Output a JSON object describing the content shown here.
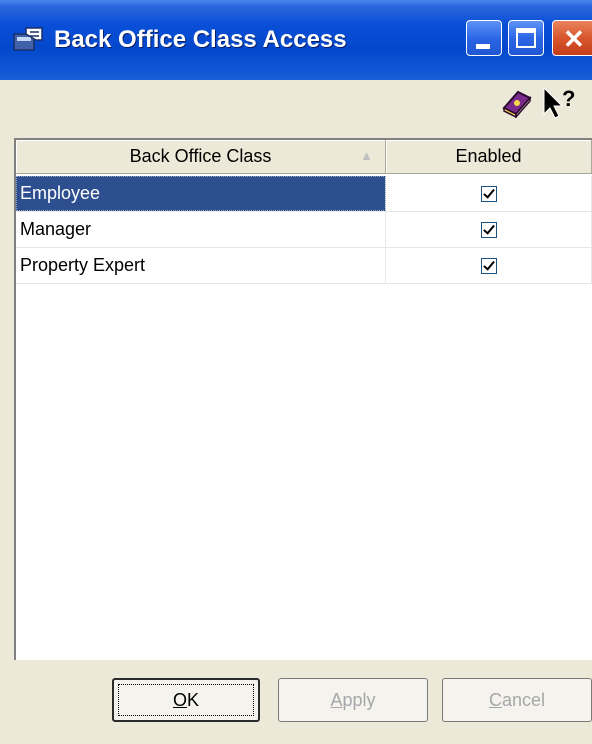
{
  "window": {
    "title": "Back Office Class Access",
    "controls": {
      "minimize": "_",
      "maximize": "□",
      "close": "✕"
    }
  },
  "toolbar": {
    "icons": [
      "book-icon",
      "help-pointer-icon"
    ]
  },
  "grid": {
    "columns": [
      "Back Office Class",
      "Enabled"
    ],
    "sort_indicator": "▲",
    "rows": [
      {
        "class": "Employee",
        "enabled": true,
        "selected": true
      },
      {
        "class": "Manager",
        "enabled": true,
        "selected": false
      },
      {
        "class": "Property Expert",
        "enabled": true,
        "selected": false
      }
    ]
  },
  "buttons": {
    "ok": {
      "mnemonic": "O",
      "rest": "K"
    },
    "apply": {
      "mnemonic": "A",
      "rest": "pply"
    },
    "cancel": {
      "mnemonic": "C",
      "rest": "ancel"
    }
  },
  "colors": {
    "title_bar": "#0348cc",
    "selection": "#2e4f8f",
    "dialog_face": "#ece9d8",
    "close_button": "#d8562d"
  }
}
